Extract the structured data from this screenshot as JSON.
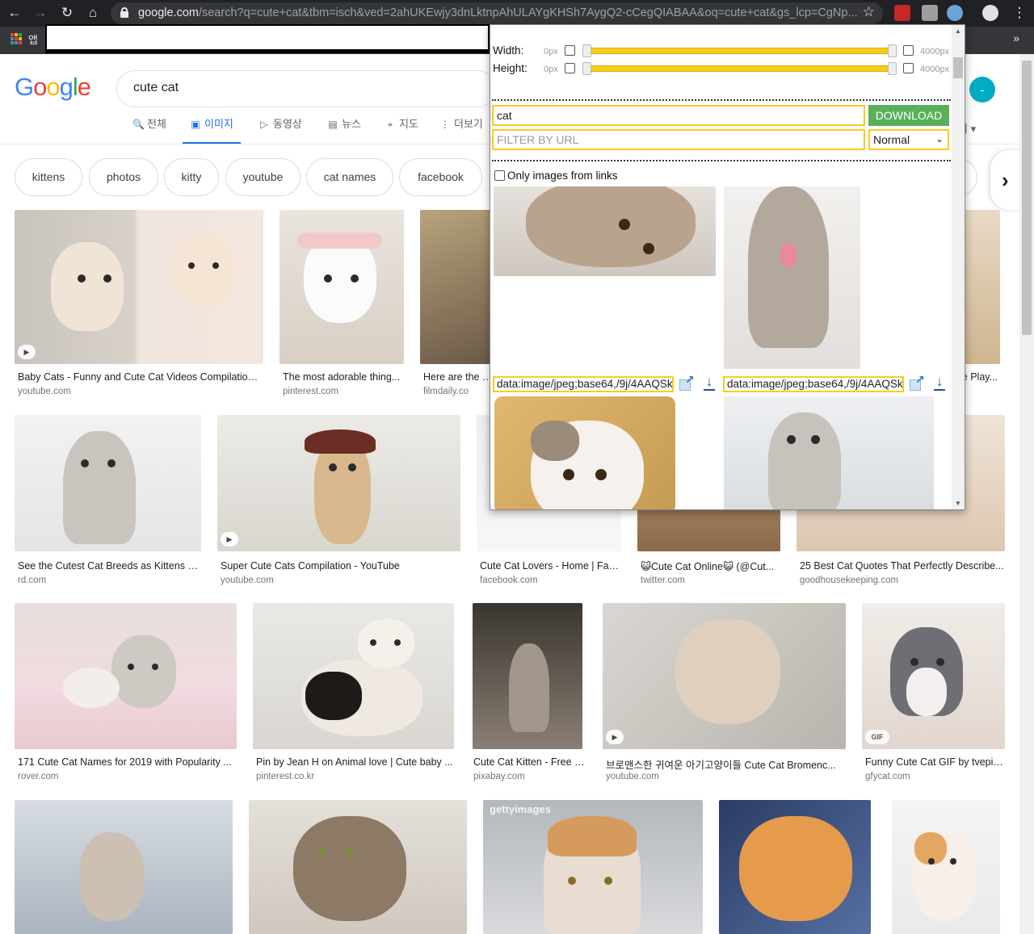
{
  "browser": {
    "url_host": "google.com",
    "url_rest": "/search?q=cute+cat&tbm=isch&ved=2ahUKEwjy3dnLktnpAhULAYgKHSh7AygQ2-cCegQIABAA&oq=cute+cat&gs_lcp=CgNp...",
    "apps_label": "앱",
    "more_bookmarks": "»"
  },
  "google": {
    "logo_letters": [
      "G",
      "o",
      "o",
      "g",
      "l",
      "e"
    ],
    "logo_colors": [
      "#4285f4",
      "#ea4335",
      "#fbbc05",
      "#4285f4",
      "#34a853",
      "#ea4335"
    ],
    "search_value": "cute cat",
    "avatar_letter": "-",
    "tabs": [
      {
        "icon": "🔍",
        "label": "전체"
      },
      {
        "icon": "▣",
        "label": "이미지"
      },
      {
        "icon": "▷",
        "label": "동영상"
      },
      {
        "icon": "▤",
        "label": "뉴스"
      },
      {
        "icon": "⌖",
        "label": "지도"
      },
      {
        "icon": "⋮",
        "label": "더보기"
      }
    ],
    "tab_right": "치 ▾",
    "chips": [
      "kittens",
      "photos",
      "kitty",
      "youtube",
      "cat names",
      "facebook"
    ]
  },
  "results": [
    {
      "title": "Baby Cats - Funny and Cute Cat Videos Compilation ...",
      "source": "youtube.com",
      "badge": "▶"
    },
    {
      "title": "The most adorable thing...",
      "source": "pinterest.com",
      "badge": ""
    },
    {
      "title": "Here are the cu",
      "source": "filmdaily.co",
      "badge": ""
    },
    {
      "title": "le Play...",
      "source": "",
      "badge": ""
    },
    {
      "title": "See the Cutest Cat Breeds as Kittens | ...",
      "source": "rd.com",
      "badge": ""
    },
    {
      "title": "Super Cute Cats Compilation - YouTube",
      "source": "youtube.com",
      "badge": "▶"
    },
    {
      "title": "Cute Cat Lovers - Home | Fac...",
      "source": "facebook.com",
      "badge": ""
    },
    {
      "title": "😺Cute Cat Online😺 (@Cut...",
      "source": "twitter.com",
      "badge": ""
    },
    {
      "title": "25 Best Cat Quotes That Perfectly Describe...",
      "source": "goodhousekeeping.com",
      "badge": ""
    },
    {
      "title": "171 Cute Cat Names for 2019 with Popularity ...",
      "source": "rover.com",
      "badge": ""
    },
    {
      "title": "Pin by Jean H on Animal love | Cute baby ...",
      "source": "pinterest.co.kr",
      "badge": ""
    },
    {
      "title": "Cute Cat Kitten - Free p...",
      "source": "pixabay.com",
      "badge": ""
    },
    {
      "title": "브로맨스한 귀여운 아기고양이들 Cute Cat Bromenc...",
      "source": "youtube.com",
      "badge": "▶"
    },
    {
      "title": "Funny Cute Cat GIF by tvepic...",
      "source": "gfycat.com",
      "badge": "GIF"
    },
    {
      "title": "",
      "source": "",
      "badge": ""
    },
    {
      "title": "",
      "source": "",
      "badge": ""
    },
    {
      "title": "",
      "source": "",
      "badge": "",
      "watermark": "gettyimages"
    },
    {
      "title": "",
      "source": "",
      "badge": ""
    },
    {
      "title": "",
      "source": "",
      "badge": ""
    }
  ],
  "extension": {
    "width_label": "Width:",
    "height_label": "Height:",
    "min_px": "0px",
    "max_px": "4000px",
    "filter_value": "cat",
    "download_label": "DOWNLOAD",
    "filter_url_placeholder": "FILTER BY URL",
    "mode_value": "Normal",
    "only_links_label": "Only images from links",
    "image_url_1": "data:image/jpeg;base64,/9j/4AAQSk",
    "image_url_2": "data:image/jpeg;base64,/9j/4AAQSk"
  }
}
